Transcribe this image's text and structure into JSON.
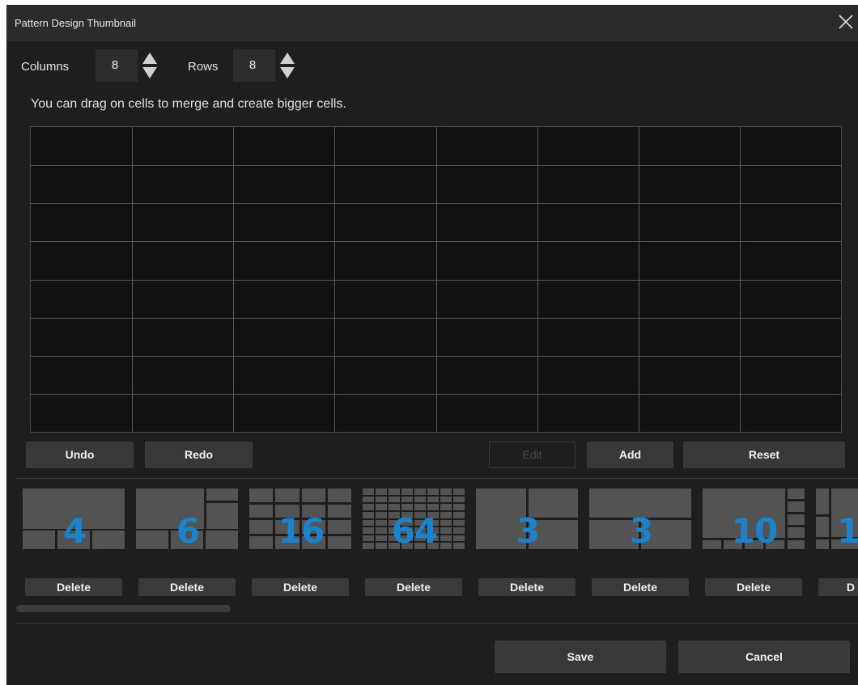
{
  "window": {
    "title": "Pattern Design Thumbnail",
    "close_icon": "close-icon"
  },
  "controls": {
    "columns_label": "Columns",
    "columns_value": "8",
    "rows_label": "Rows",
    "rows_value": "8"
  },
  "hint": "You can drag on cells to merge and create bigger cells.",
  "grid": {
    "columns": 8,
    "rows": 8
  },
  "toolbar": {
    "undo_label": "Undo",
    "redo_label": "Redo",
    "edit_label": "Edit",
    "add_label": "Add",
    "reset_label": "Reset"
  },
  "thumbnails": [
    {
      "count": "4",
      "delete_label": "Delete"
    },
    {
      "count": "6",
      "delete_label": "Delete"
    },
    {
      "count": "16",
      "delete_label": "Delete"
    },
    {
      "count": "64",
      "delete_label": "Delete"
    },
    {
      "count": "3",
      "delete_label": "Delete"
    },
    {
      "count": "3",
      "delete_label": "Delete"
    },
    {
      "count": "10",
      "delete_label": "Delete"
    },
    {
      "count": "1",
      "delete_label": "D"
    }
  ],
  "footer": {
    "save_label": "Save",
    "cancel_label": "Cancel"
  },
  "colors": {
    "background": "#1e1e1e",
    "titlebar": "#2b2b2b",
    "button": "#383838",
    "thumb_cell": "#535353",
    "accent_number": "#1a83cc"
  }
}
